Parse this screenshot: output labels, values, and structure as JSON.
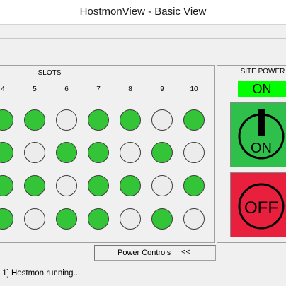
{
  "window": {
    "title": "HostmonView - Basic View"
  },
  "slots": {
    "label": "SLOTS",
    "columns": [
      "4",
      "5",
      "6",
      "7",
      "8",
      "9",
      "10"
    ],
    "rows": [
      [
        "on",
        "on",
        "off",
        "on",
        "on",
        "off",
        "on"
      ],
      [
        "on",
        "off",
        "on",
        "on",
        "off",
        "on",
        "off"
      ],
      [
        "on",
        "on",
        "off",
        "on",
        "on",
        "off",
        "on"
      ],
      [
        "on",
        "off",
        "on",
        "on",
        "off",
        "on",
        "off"
      ]
    ]
  },
  "site_power": {
    "label": "SITE POWER",
    "status": "ON",
    "on_button_label": "ON",
    "off_button_label": "OFF"
  },
  "power_controls": {
    "label": "Power Controls",
    "toggle": "<<"
  },
  "status_bar": {
    "message": ".1] Hostmon running..."
  },
  "colors": {
    "status_on": "#00ff00",
    "led_on": "#33c438",
    "led_off": "#ececec",
    "on_button": "#2ec04b",
    "off_button": "#e8203e"
  }
}
